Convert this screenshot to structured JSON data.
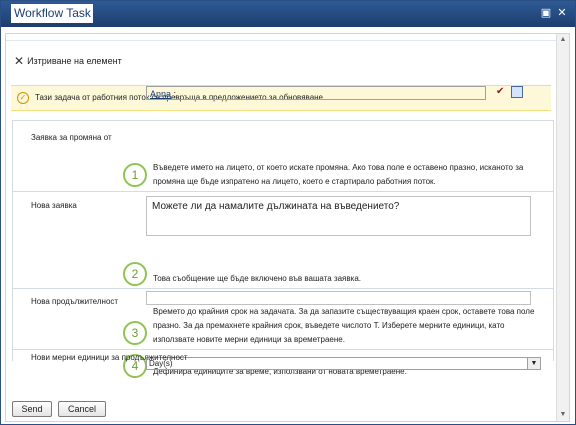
{
  "window": {
    "title": "Workflow Task",
    "maximize_glyph": "▣",
    "close_glyph": "✕"
  },
  "ribbon": {
    "delete_label": "Изтриване на елемент"
  },
  "notice": {
    "text": "Тази задача от работния поток се превръща в предложението за обновяване."
  },
  "form": {
    "rows": [
      {
        "label": "Заявка за промяна от",
        "number": "1",
        "value_user": "Anna",
        "value_suffix": " ;",
        "description": "Въведете името на лицето, от което искате промяна. Ако това поле е оставено празно, исканото за промяна ще бъде изпратено на лицето, което е стартирало работния поток."
      },
      {
        "label": "Нова заявка",
        "number": "2",
        "value": "Можете ли да намалите дължината на въведението?",
        "description": "Това съобщение ще бъде включено във вашата заявка."
      },
      {
        "label": "Нова продължителност",
        "number": "3",
        "value": "",
        "description": "Времето до крайния срок на задачата. За да запазите съществуващия краен срок, оставете това поле празно. За да премахнете крайния срок, въведете числото Т. Изберете мерните единици, като използвате новите мерни единици за времетраене."
      },
      {
        "label": "Нови мерни единици за продължителност",
        "number": "4",
        "value": "Day(s)",
        "description": "Дефинира единиците за време, използвани от новата времетраене."
      }
    ]
  },
  "buttons": {
    "send": "Send",
    "cancel": "Cancel"
  },
  "colors": {
    "titlebar": "#1d3e6e",
    "number_ring": "#8fc452",
    "notice_bg": "#fdf8d8"
  }
}
